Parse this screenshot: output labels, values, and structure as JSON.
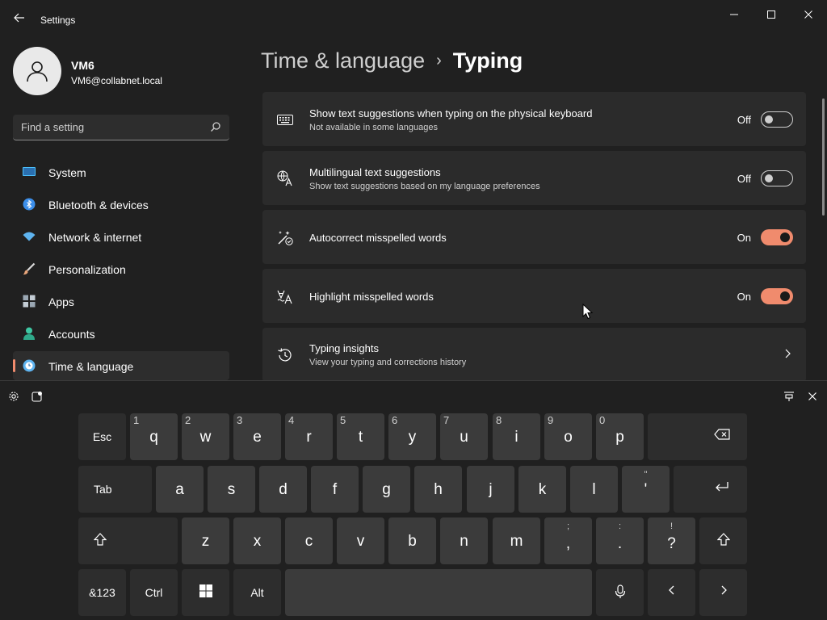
{
  "window": {
    "title": "Settings",
    "back_icon": "back-arrow-icon",
    "controls": [
      "minimize-icon",
      "maximize-icon",
      "close-icon"
    ]
  },
  "profile": {
    "name": "VM6",
    "email": "VM6@collabnet.local",
    "avatar_icon": "person-icon"
  },
  "search": {
    "placeholder": "Find a setting",
    "icon": "search-icon"
  },
  "sidebar": {
    "items": [
      {
        "label": "System",
        "icon": "monitor-icon",
        "color": "#4cc2ff"
      },
      {
        "label": "Bluetooth & devices",
        "icon": "bluetooth-icon",
        "color": "#3b8eea"
      },
      {
        "label": "Network & internet",
        "icon": "wifi-icon",
        "color": "#5fb4f0"
      },
      {
        "label": "Personalization",
        "icon": "brush-icon",
        "color": "#e8a57a"
      },
      {
        "label": "Apps",
        "icon": "apps-icon",
        "color": "#9aa7b3"
      },
      {
        "label": "Accounts",
        "icon": "account-icon",
        "color": "#3ec7a3"
      },
      {
        "label": "Time & language",
        "icon": "globe-clock-icon",
        "color": "#5fb4f0",
        "active": true
      }
    ]
  },
  "header": {
    "parent": "Time & language",
    "separator": "›",
    "current": "Typing"
  },
  "settings": [
    {
      "title": "Show text suggestions when typing on the physical keyboard",
      "subtitle": "Not available in some languages",
      "icon": "keyboard-icon",
      "state": "Off"
    },
    {
      "title": "Multilingual text suggestions",
      "subtitle": "Show text suggestions based on my language preferences",
      "icon": "language-icon",
      "state": "Off"
    },
    {
      "title": "Autocorrect misspelled words",
      "subtitle": "",
      "icon": "autocorrect-icon",
      "state": "On"
    },
    {
      "title": "Highlight misspelled words",
      "subtitle": "",
      "icon": "highlight-text-icon",
      "state": "On"
    },
    {
      "title": "Typing insights",
      "subtitle": "View your typing and corrections history",
      "icon": "history-icon",
      "state": ""
    }
  ],
  "colors": {
    "accent": "#f08b6d",
    "background": "#202020",
    "card": "#2b2b2b"
  },
  "keyboard": {
    "tools": [
      "settings-gear-icon",
      "emoji-panel-icon",
      "dock-icon",
      "close-icon"
    ],
    "row1": {
      "esc": "Esc",
      "letters": [
        "q",
        "w",
        "e",
        "r",
        "t",
        "y",
        "u",
        "i",
        "o",
        "p"
      ],
      "numbers": [
        "1",
        "2",
        "3",
        "4",
        "5",
        "6",
        "7",
        "8",
        "9",
        "0"
      ]
    },
    "row2": {
      "tab": "Tab",
      "letters": [
        "a",
        "s",
        "d",
        "f",
        "g",
        "h",
        "j",
        "k",
        "l"
      ],
      "apostrophe": {
        "main": "'",
        "secondary": "\""
      }
    },
    "row3": {
      "letters": [
        "z",
        "x",
        "c",
        "v",
        "b",
        "n",
        "m"
      ],
      "comma": {
        "main": ",",
        "secondary": ";"
      },
      "period": {
        "main": ".",
        "secondary": ":"
      },
      "question": {
        "main": "?",
        "secondary": "!"
      }
    },
    "row4": {
      "symbols": "&123",
      "ctrl": "Ctrl",
      "alt": "Alt"
    }
  }
}
